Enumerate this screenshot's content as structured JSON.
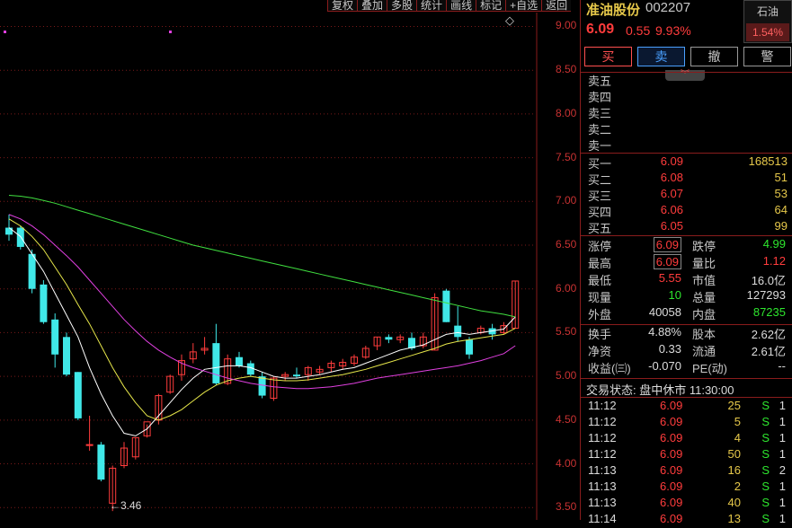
{
  "toolbar": {
    "items": [
      "复权",
      "叠加",
      "多股",
      "统计",
      "画线",
      "标记",
      "+自选",
      "返回"
    ]
  },
  "chart_data": {
    "type": "candlestick",
    "y_ticks": [
      "9.00",
      "8.50",
      "8.00",
      "7.50",
      "7.00",
      "6.50",
      "6.00",
      "5.50",
      "5.00",
      "4.50",
      "4.00",
      "3.50"
    ],
    "ylim": [
      3.4,
      9.2
    ],
    "min_label": "←3.46",
    "candles": [
      {
        "o": 6.7,
        "h": 6.85,
        "l": 6.55,
        "c": 6.62
      },
      {
        "o": 6.7,
        "h": 6.72,
        "l": 6.45,
        "c": 6.48
      },
      {
        "o": 6.4,
        "h": 6.45,
        "l": 5.95,
        "c": 6.0
      },
      {
        "o": 6.05,
        "h": 6.1,
        "l": 5.6,
        "c": 5.62
      },
      {
        "o": 5.65,
        "h": 5.72,
        "l": 5.1,
        "c": 5.25
      },
      {
        "o": 5.45,
        "h": 5.5,
        "l": 5.0,
        "c": 5.02
      },
      {
        "o": 5.05,
        "h": 5.05,
        "l": 4.5,
        "c": 4.52
      },
      {
        "o": 4.22,
        "h": 4.55,
        "l": 4.15,
        "c": 4.22
      },
      {
        "o": 4.22,
        "h": 4.25,
        "l": 3.8,
        "c": 3.82
      },
      {
        "o": 3.55,
        "h": 3.98,
        "l": 3.46,
        "c": 3.95
      },
      {
        "o": 3.98,
        "h": 4.25,
        "l": 3.95,
        "c": 4.18
      },
      {
        "o": 4.08,
        "h": 4.3,
        "l": 4.05,
        "c": 4.3
      },
      {
        "o": 4.32,
        "h": 4.45,
        "l": 4.3,
        "c": 4.48
      },
      {
        "o": 4.5,
        "h": 4.8,
        "l": 4.45,
        "c": 4.78
      },
      {
        "o": 4.82,
        "h": 5.02,
        "l": 4.8,
        "c": 5.0
      },
      {
        "o": 5.02,
        "h": 5.25,
        "l": 4.95,
        "c": 5.18
      },
      {
        "o": 5.2,
        "h": 5.38,
        "l": 5.15,
        "c": 5.28
      },
      {
        "o": 5.3,
        "h": 5.45,
        "l": 5.25,
        "c": 5.32
      },
      {
        "o": 5.38,
        "h": 5.6,
        "l": 4.9,
        "c": 4.92
      },
      {
        "o": 4.92,
        "h": 5.25,
        "l": 4.9,
        "c": 5.2
      },
      {
        "o": 5.22,
        "h": 5.28,
        "l": 5.1,
        "c": 5.12
      },
      {
        "o": 5.15,
        "h": 5.18,
        "l": 5.0,
        "c": 5.02
      },
      {
        "o": 5.0,
        "h": 5.05,
        "l": 4.75,
        "c": 4.78
      },
      {
        "o": 4.75,
        "h": 5.0,
        "l": 4.72,
        "c": 4.98
      },
      {
        "o": 5.0,
        "h": 5.05,
        "l": 4.95,
        "c": 5.02
      },
      {
        "o": 5.02,
        "h": 5.1,
        "l": 4.98,
        "c": 5.0
      },
      {
        "o": 5.02,
        "h": 5.12,
        "l": 4.95,
        "c": 5.1
      },
      {
        "o": 5.05,
        "h": 5.12,
        "l": 5.02,
        "c": 5.08
      },
      {
        "o": 5.1,
        "h": 5.18,
        "l": 5.05,
        "c": 5.15
      },
      {
        "o": 5.12,
        "h": 5.2,
        "l": 5.08,
        "c": 5.16
      },
      {
        "o": 5.15,
        "h": 5.25,
        "l": 5.12,
        "c": 5.22
      },
      {
        "o": 5.22,
        "h": 5.35,
        "l": 5.2,
        "c": 5.32
      },
      {
        "o": 5.35,
        "h": 5.45,
        "l": 5.3,
        "c": 5.45
      },
      {
        "o": 5.45,
        "h": 5.48,
        "l": 5.38,
        "c": 5.42
      },
      {
        "o": 5.42,
        "h": 5.48,
        "l": 5.38,
        "c": 5.45
      },
      {
        "o": 5.44,
        "h": 5.5,
        "l": 5.3,
        "c": 5.32
      },
      {
        "o": 5.35,
        "h": 5.5,
        "l": 5.32,
        "c": 5.45
      },
      {
        "o": 5.3,
        "h": 5.95,
        "l": 5.3,
        "c": 5.9
      },
      {
        "o": 5.98,
        "h": 6.0,
        "l": 5.62,
        "c": 5.62
      },
      {
        "o": 5.58,
        "h": 5.8,
        "l": 5.4,
        "c": 5.45
      },
      {
        "o": 5.42,
        "h": 5.45,
        "l": 5.2,
        "c": 5.25
      },
      {
        "o": 5.5,
        "h": 5.58,
        "l": 5.48,
        "c": 5.55
      },
      {
        "o": 5.55,
        "h": 5.6,
        "l": 5.42,
        "c": 5.48
      },
      {
        "o": 5.5,
        "h": 5.62,
        "l": 5.48,
        "c": 5.58
      },
      {
        "o": 5.55,
        "h": 6.09,
        "l": 5.55,
        "c": 6.09
      }
    ],
    "ma_lines": [
      {
        "color": "#ffffff",
        "values": [
          6.7,
          6.6,
          6.4,
          6.2,
          5.95,
          5.7,
          5.45,
          5.1,
          4.8,
          4.55,
          4.35,
          4.32,
          4.4,
          4.55,
          4.7,
          4.85,
          4.98,
          5.08,
          5.1,
          5.12,
          5.12,
          5.1,
          5.05,
          5.0,
          4.98,
          4.98,
          5.0,
          5.02,
          5.05,
          5.08,
          5.1,
          5.15,
          5.2,
          5.25,
          5.3,
          5.33,
          5.36,
          5.42,
          5.48,
          5.5,
          5.48,
          5.5,
          5.52,
          5.54,
          5.68
        ]
      },
      {
        "color": "#e6e64a",
        "values": [
          6.8,
          6.72,
          6.6,
          6.45,
          6.25,
          6.05,
          5.82,
          5.6,
          5.35,
          5.1,
          4.88,
          4.7,
          4.55,
          4.5,
          4.55,
          4.62,
          4.72,
          4.82,
          4.9,
          4.95,
          4.98,
          5.0,
          4.98,
          4.96,
          4.95,
          4.95,
          4.96,
          4.98,
          5.0,
          5.02,
          5.05,
          5.08,
          5.12,
          5.16,
          5.2,
          5.24,
          5.28,
          5.32,
          5.37,
          5.4,
          5.42,
          5.44,
          5.46,
          5.48,
          5.55
        ]
      },
      {
        "color": "#e040e0",
        "values": [
          6.85,
          6.8,
          6.72,
          6.62,
          6.5,
          6.38,
          6.25,
          6.1,
          5.95,
          5.8,
          5.65,
          5.52,
          5.4,
          5.3,
          5.22,
          5.15,
          5.1,
          5.06,
          5.02,
          4.98,
          4.95,
          4.92,
          4.9,
          4.88,
          4.87,
          4.86,
          4.86,
          4.87,
          4.88,
          4.9,
          4.92,
          4.95,
          4.98,
          5.0,
          5.02,
          5.04,
          5.06,
          5.08,
          5.1,
          5.12,
          5.15,
          5.18,
          5.22,
          5.26,
          5.35
        ]
      },
      {
        "color": "#40e040",
        "values": [
          7.07,
          7.06,
          7.04,
          7.01,
          6.98,
          6.94,
          6.9,
          6.86,
          6.82,
          6.78,
          6.74,
          6.7,
          6.66,
          6.62,
          6.58,
          6.54,
          6.5,
          6.47,
          6.44,
          6.41,
          6.38,
          6.35,
          6.32,
          6.29,
          6.26,
          6.23,
          6.2,
          6.17,
          6.14,
          6.11,
          6.08,
          6.05,
          6.02,
          5.99,
          5.96,
          5.93,
          5.9,
          5.87,
          5.84,
          5.81,
          5.78,
          5.75,
          5.73,
          5.71,
          5.68
        ]
      }
    ]
  },
  "stock": {
    "name": "准油股份",
    "code": "002207",
    "price": "6.09",
    "change": "0.55",
    "change_pct": "9.93%"
  },
  "sector": {
    "name": "石油",
    "pct": "1.54%"
  },
  "actions": {
    "buy": "买",
    "sell": "卖",
    "cancel": "撤",
    "warn": "警"
  },
  "collapse_icon": "chevron-down-icon",
  "asks": [
    {
      "label": "卖五",
      "price": "",
      "vol": ""
    },
    {
      "label": "卖四",
      "price": "",
      "vol": ""
    },
    {
      "label": "卖三",
      "price": "",
      "vol": ""
    },
    {
      "label": "卖二",
      "price": "",
      "vol": ""
    },
    {
      "label": "卖一",
      "price": "",
      "vol": ""
    }
  ],
  "bids": [
    {
      "label": "买一",
      "price": "6.09",
      "vol": "168513"
    },
    {
      "label": "买二",
      "price": "6.08",
      "vol": "51"
    },
    {
      "label": "买三",
      "price": "6.07",
      "vol": "53"
    },
    {
      "label": "买四",
      "price": "6.06",
      "vol": "64"
    },
    {
      "label": "买五",
      "price": "6.05",
      "vol": "99"
    }
  ],
  "stats": [
    {
      "l1": "涨停",
      "v1": "6.09",
      "c1": "red",
      "b1": true,
      "l2": "跌停",
      "v2": "4.99",
      "c2": "green"
    },
    {
      "l1": "最高",
      "v1": "6.09",
      "c1": "red",
      "b1": true,
      "l2": "量比",
      "v2": "1.12",
      "c2": "red"
    },
    {
      "l1": "最低",
      "v1": "5.55",
      "c1": "red",
      "b1": false,
      "l2": "市值",
      "v2": "16.0亿",
      "c2": "white"
    },
    {
      "l1": "现量",
      "v1": "10",
      "c1": "green",
      "b1": false,
      "l2": "总量",
      "v2": "127293",
      "c2": "white"
    },
    {
      "l1": "外盘",
      "v1": "40058",
      "c1": "white",
      "b1": false,
      "l2": "内盘",
      "v2": "87235",
      "c2": "green"
    }
  ],
  "stats2": [
    {
      "l1": "换手",
      "v1": "4.88%",
      "l2": "股本",
      "v2": "2.62亿"
    },
    {
      "l1": "净资",
      "v1": "0.33",
      "l2": "流通",
      "v2": "2.61亿"
    },
    {
      "l1": "收益(㈢)",
      "v1": "-0.070",
      "l2": "PE(动)",
      "v2": "--"
    }
  ],
  "status": "交易状态: 盘中休市 11:30:00",
  "ticks": [
    {
      "t": "11:12",
      "p": "6.09",
      "v": "25",
      "s": "S",
      "n": "1"
    },
    {
      "t": "11:12",
      "p": "6.09",
      "v": "5",
      "s": "S",
      "n": "1"
    },
    {
      "t": "11:12",
      "p": "6.09",
      "v": "4",
      "s": "S",
      "n": "1"
    },
    {
      "t": "11:12",
      "p": "6.09",
      "v": "50",
      "s": "S",
      "n": "1"
    },
    {
      "t": "11:13",
      "p": "6.09",
      "v": "16",
      "s": "S",
      "n": "2"
    },
    {
      "t": "11:13",
      "p": "6.09",
      "v": "2",
      "s": "S",
      "n": "1"
    },
    {
      "t": "11:13",
      "p": "6.09",
      "v": "40",
      "s": "S",
      "n": "1"
    },
    {
      "t": "11:14",
      "p": "6.09",
      "v": "13",
      "s": "S",
      "n": "1"
    }
  ]
}
